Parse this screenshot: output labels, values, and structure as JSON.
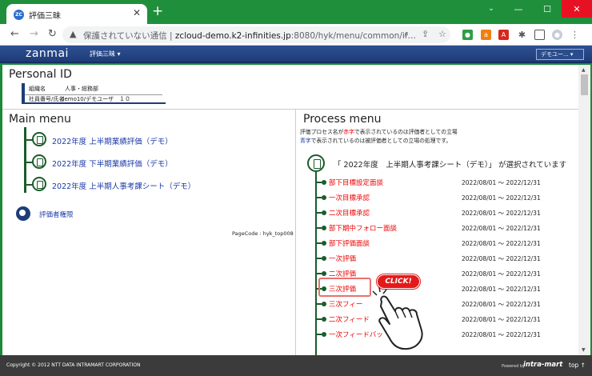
{
  "browser": {
    "tab_title": "評価三昧",
    "tab_favicon": "ZC",
    "new_tab": "+",
    "url_warning": "保護されていない通信",
    "url_host": "zcloud-demo.k2-infinities.jp",
    "url_rest": ":8080/hyk/menu/common/if…"
  },
  "app": {
    "logo": "zanmai",
    "menu_label": "評価三昧 ▾",
    "user_button": "デモユー... ▾"
  },
  "personal_id": {
    "title": "Personal ID",
    "org_label": "組織名",
    "org_value": "人事・総務部",
    "emp_label": "社員番号/氏名",
    "emp_value": "demo10/デモユーザ　１０"
  },
  "main_menu": {
    "title": "Main menu",
    "items": [
      "2022年度 上半期業績評価（デモ）",
      "2022年度 下半期業績評価（デモ）",
      "2022年度 上半期人事考課シート（デモ）"
    ],
    "permission_link": "評価者権限",
    "page_code": "PageCode : hyk_top008"
  },
  "process_menu": {
    "title": "Process menu",
    "desc1_pre": "評価プロセス名が",
    "desc1_red": "赤字",
    "desc1_post": "で表示されているのは評価者としての立場",
    "desc2_blue": "青字",
    "desc2_post": "で表示されているのは被評価者としての立場の処理です。",
    "selected": "「 2022年度　上半期人事考課シート（デモ）」 が選択されています",
    "steps": [
      {
        "label": "部下目標設定面談",
        "date": "2022/08/01 ～ 2022/12/31"
      },
      {
        "label": "一次目標承認",
        "date": "2022/08/01 ～ 2022/12/31"
      },
      {
        "label": "二次目標承認",
        "date": "2022/08/01 ～ 2022/12/31"
      },
      {
        "label": "部下期中フォロー面談",
        "date": "2022/08/01 ～ 2022/12/31"
      },
      {
        "label": "部下評価面談",
        "date": "2022/08/01 ～ 2022/12/31"
      },
      {
        "label": "一次評価",
        "date": "2022/08/01 ～ 2022/12/31"
      },
      {
        "label": "二次評価",
        "date": "2022/08/01 ～ 2022/12/31"
      },
      {
        "label": "三次評価",
        "date": "2022/08/01 ～ 2022/12/31"
      },
      {
        "label": "三次フィー",
        "date": "2022/08/01 ～ 2022/12/31"
      },
      {
        "label": "二次フィード",
        "date": "2022/08/01 ～ 2022/12/31"
      },
      {
        "label": "一次フィードバッ",
        "date": "2022/08/01 ～ 2022/12/31"
      }
    ],
    "click_badge": "CLICK!"
  },
  "footer": {
    "copyright": "Copyright © 2012 NTT DATA INTRAMART CORPORATION",
    "powered": "Powered by",
    "brand": "intra-mart",
    "top_link": "top ↑"
  },
  "colors": {
    "browser_frame": "#1f8f3c",
    "app_header": "#1f3c78",
    "menu_link": "#1a3aa8",
    "process_red": "#e00000",
    "tree_green": "#1a5c2a",
    "click_red": "#e31a1a"
  }
}
